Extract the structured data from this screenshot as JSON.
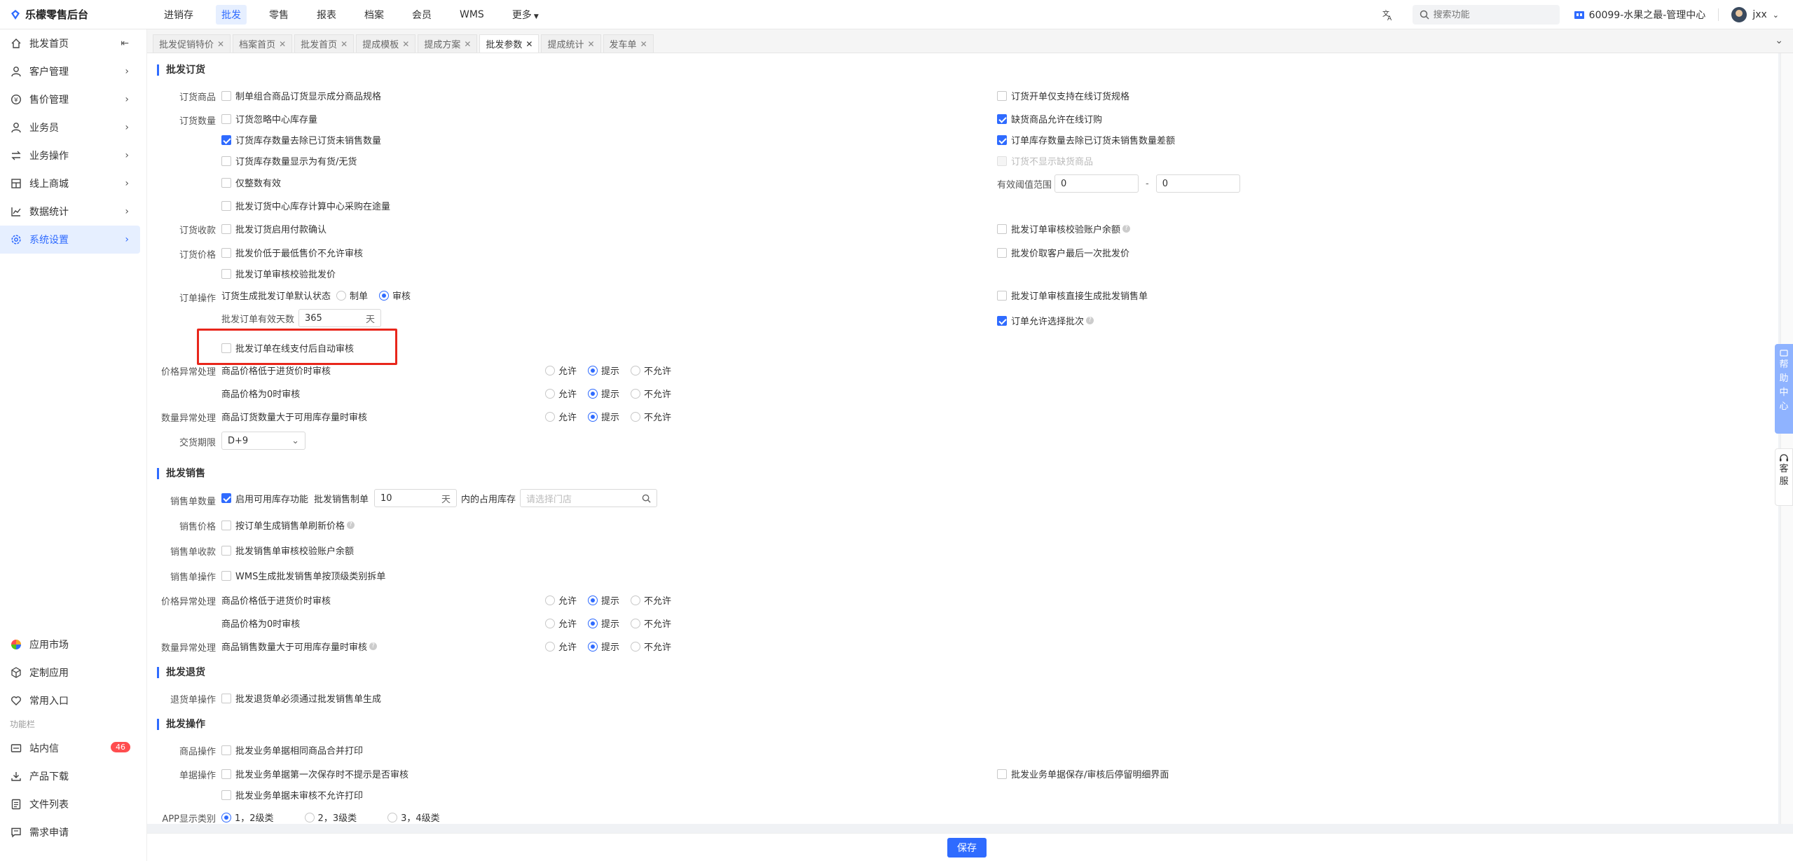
{
  "brand": {
    "title": "乐檬零售后台"
  },
  "topnav": [
    {
      "label": "进销存",
      "active": false
    },
    {
      "label": "批发",
      "active": true
    },
    {
      "label": "零售",
      "active": false
    },
    {
      "label": "报表",
      "active": false
    },
    {
      "label": "档案",
      "active": false
    },
    {
      "label": "会员",
      "active": false
    },
    {
      "label": "WMS",
      "active": false
    },
    {
      "label": "更多",
      "active": false
    }
  ],
  "search": {
    "placeholder": "搜索功能"
  },
  "store": {
    "name": "60099-水果之最-管理中心"
  },
  "user": {
    "name": "jxx"
  },
  "sidebar": {
    "items": [
      {
        "label": "批发首页"
      },
      {
        "label": "客户管理"
      },
      {
        "label": "售价管理"
      },
      {
        "label": "业务员"
      },
      {
        "label": "业务操作"
      },
      {
        "label": "线上商城"
      },
      {
        "label": "数据统计"
      },
      {
        "label": "系统设置"
      }
    ],
    "bottom": [
      {
        "label": "应用市场"
      },
      {
        "label": "定制应用"
      },
      {
        "label": "常用入口"
      }
    ],
    "section_label": "功能栏",
    "func": [
      {
        "label": "站内信",
        "badge": "46"
      },
      {
        "label": "产品下载"
      },
      {
        "label": "文件列表"
      },
      {
        "label": "需求申请"
      }
    ]
  },
  "tabs": [
    {
      "label": "批发促销特价"
    },
    {
      "label": "档案首页"
    },
    {
      "label": "批发首页"
    },
    {
      "label": "提成模板"
    },
    {
      "label": "提成方案"
    },
    {
      "label": "批发参数"
    },
    {
      "label": "提成统计"
    },
    {
      "label": "发车单"
    }
  ],
  "s1": {
    "title": "批发订货",
    "lbl_goods": "订货商品",
    "goods_1": "制单组合商品订货显示成分商品规格",
    "goods_r": "订货开单仅支持在线订货规格",
    "lbl_qty": "订货数量",
    "qty_1": "订货忽略中心库存量",
    "qty_r1": "缺货商品允许在线订购",
    "qty_2": "订货库存数量去除已订货未销售数量",
    "qty_r2": "订单库存数量去除已订货未销售数量差额",
    "qty_3": "订货库存数量显示为有货/无货",
    "qty_r3": "订货不显示缺货商品",
    "qty_4": "仅整数有效",
    "qty_r4_label": "有效阈值范围",
    "qty_r4_min": "0",
    "qty_r4_dash": "-",
    "qty_r4_max": "0",
    "qty_5": "批发订货中心库存计算中心采购在途量",
    "lbl_pay": "订货收款",
    "pay_1": "批发订货启用付款确认",
    "pay_r": "批发订单审核校验账户余额",
    "lbl_price": "订货价格",
    "price_1": "批发价低于最低售价不允许审核",
    "price_r": "批发价取客户最后一次批发价",
    "price_2": "批发订单审核校验批发价",
    "lbl_op": "订单操作",
    "op_default": "订货生成批发订单默认状态",
    "op_draft": "制单",
    "op_audit": "审核",
    "op_r": "批发订单审核直接生成批发销售单",
    "op_days_label": "批发订单有效天数",
    "op_days": "365",
    "op_days_unit": "天",
    "op_r2": "订单允许选择批次",
    "op_auto": "批发订单在线支付后自动审核",
    "lbl_price_exc": "价格异常处理",
    "pe_1": "商品价格低于进货价时审核",
    "pe_2": "商品价格为0时审核",
    "lbl_qty_exc": "数量异常处理",
    "qe_1": "商品订货数量大于可用库存量时审核",
    "opt_allow": "允许",
    "opt_prompt": "提示",
    "opt_deny": "不允许",
    "lbl_delivery": "交货期限",
    "delivery": "D+9"
  },
  "s2": {
    "title": "批发销售",
    "lbl_qty": "销售单数量",
    "qty_1": "启用可用库存功能",
    "qty_text": "批发销售制单",
    "qty_val": "10",
    "qty_unit": "天",
    "qty_text2": "内的占用库存",
    "store_placeholder": "请选择门店",
    "lbl_price": "销售价格",
    "price_1": "按订单生成销售单刷新价格",
    "lbl_pay": "销售单收款",
    "pay_1": "批发销售单审核校验账户余额",
    "lbl_op": "销售单操作",
    "op_1": "WMS生成批发销售单按顶级类别拆单",
    "lbl_price_exc": "价格异常处理",
    "pe_1": "商品价格低于进货价时审核",
    "pe_2": "商品价格为0时审核",
    "lbl_qty_exc": "数量异常处理",
    "qe_1": "商品销售数量大于可用库存量时审核"
  },
  "s3": {
    "title": "批发退货",
    "lbl_op": "退货单操作",
    "op_1": "批发退货单必须通过批发销售单生成"
  },
  "s4": {
    "title": "批发操作",
    "lbl_goods": "商品操作",
    "goods_1": "批发业务单据相同商品合并打印",
    "lbl_doc": "单据操作",
    "doc_1": "批发业务单据第一次保存时不提示是否审核",
    "doc_r": "批发业务单据保存/审核后停留明细界面",
    "doc_2": "批发业务单据未审核不允许打印",
    "lbl_app": "APP显示类别",
    "app_1": "1，2级类",
    "app_2": "2，3级类",
    "app_3": "3，4级类"
  },
  "footer": {
    "save": "保存"
  },
  "float": {
    "help": [
      "帮",
      "助",
      "中",
      "心"
    ],
    "cs": [
      "客",
      "服"
    ]
  },
  "colors": {
    "accent": "#2f6bff",
    "highlight": "#e8261b"
  }
}
